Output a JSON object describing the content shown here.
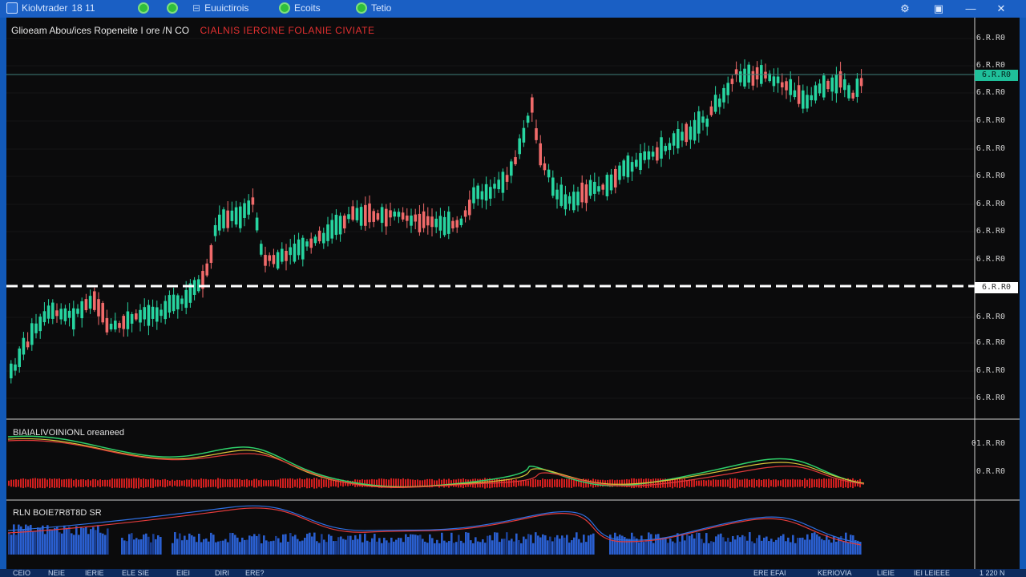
{
  "titlebar": {
    "app_name": "Kiolvtrader",
    "counter": "18  11",
    "tab1_label": "Euuictirois",
    "tab2_label": "Ecoits",
    "tab3_label": "Tetio"
  },
  "chart": {
    "symbol_title": "Glioeam  Abou/ices  Ropeneite  I ore  /N CO",
    "symbol_title_red": "CIALNIS  IERCINE  FOLANIE  CIVIATE",
    "price_labels": [
      "6.R.R0",
      "6.R.R0",
      "6.R.R0",
      "6.R.R0",
      "6.R.R0",
      "6.R.R0",
      "6.R.R0",
      "6.R.R0",
      "6.R.R0",
      "6.R.R0",
      "6.R.R0",
      "6.R.R0",
      "6.R.R0"
    ],
    "current_price_tag": "6.R.R0",
    "level_tag": "6.R.R0",
    "colors": {
      "up": "#27d4a0",
      "down": "#f06a6a",
      "level_line": "#ffffff",
      "accent": "#1a5fc4"
    }
  },
  "indicator1": {
    "label": "BIAIALIVOINIONL oreaneed",
    "axis_labels": [
      "01.R.R0",
      "0.R.R0"
    ]
  },
  "indicator2": {
    "label": "RLN  BOIE7R8T8D  SR"
  },
  "bottom_bar": {
    "items": [
      "CEIO",
      "NEIE",
      "IERIE",
      "ELE SIE",
      "EIEI",
      "DIRI",
      "ERE?",
      "ERE EFAI",
      "KERIOVIA",
      "LIEIE",
      "IEI LEIEEE",
      "1 220 N"
    ]
  }
}
